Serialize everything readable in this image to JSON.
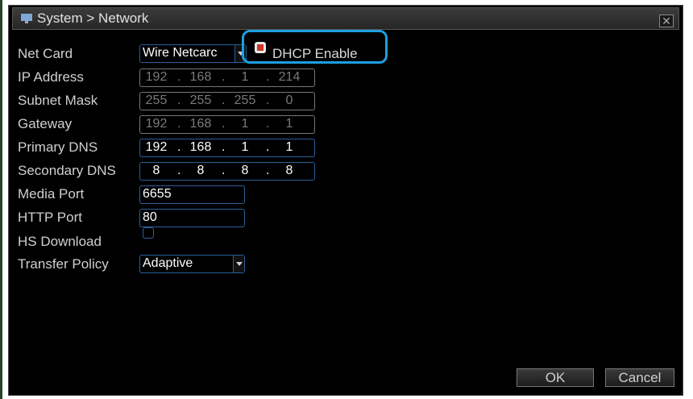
{
  "window": {
    "title": "System > Network",
    "close": "✕"
  },
  "form": {
    "net_card": {
      "label": "Net Card",
      "value": "Wire Netcarc"
    },
    "dhcp": {
      "label": "DHCP Enable",
      "checked": true
    },
    "ip_address": {
      "label": "IP Address",
      "octets": [
        "192",
        "168",
        "1",
        "214"
      ]
    },
    "subnet_mask": {
      "label": "Subnet Mask",
      "octets": [
        "255",
        "255",
        "255",
        "0"
      ]
    },
    "gateway": {
      "label": "Gateway",
      "octets": [
        "192",
        "168",
        "1",
        "1"
      ]
    },
    "primary_dns": {
      "label": "Primary DNS",
      "octets": [
        "192",
        "168",
        "1",
        "1"
      ]
    },
    "secondary_dns": {
      "label": "Secondary DNS",
      "octets": [
        "8",
        "8",
        "8",
        "8"
      ]
    },
    "media_port": {
      "label": "Media Port",
      "value": "6655"
    },
    "http_port": {
      "label": "HTTP Port",
      "value": "80"
    },
    "hs_download": {
      "label": "HS Download",
      "checked": false
    },
    "transfer_policy": {
      "label": "Transfer Policy",
      "value": "Adaptive"
    }
  },
  "buttons": {
    "ok": "OK",
    "cancel": "Cancel"
  },
  "colors": {
    "accent_border": "#2a5f9a",
    "highlight": "#1e9fe0",
    "check_red": "#d0352b"
  }
}
